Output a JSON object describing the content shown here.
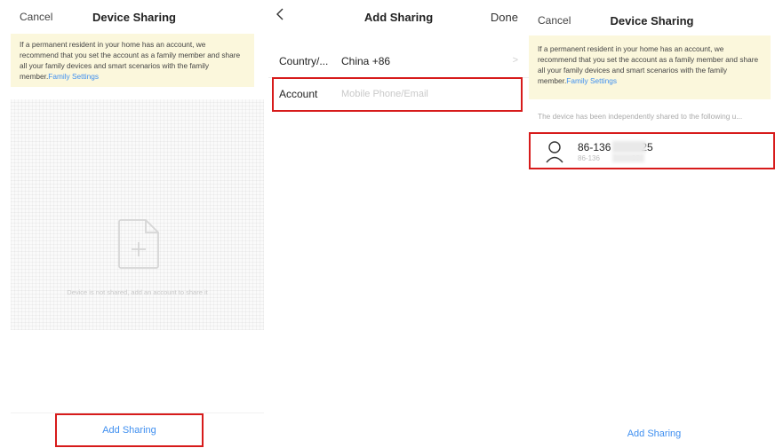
{
  "panel1": {
    "nav": {
      "cancel": "Cancel",
      "title": "Device Sharing"
    },
    "notice": {
      "text": "If a permanent resident in your home has an account, we recommend that you set the account as a family member and share all your family devices and smart scenarios with the family member.",
      "link": "Family Settings"
    },
    "empty_text": "Device is not shared, add an account to share it",
    "empty_icon": "add-file-icon",
    "add_button": "Add Sharing"
  },
  "panel2": {
    "nav": {
      "back_icon": "chevron-left-icon",
      "back": "<",
      "title": "Add Sharing",
      "done": "Done"
    },
    "country": {
      "label": "Country/...",
      "value": "China +86",
      "chevron": ">"
    },
    "account": {
      "label": "Account",
      "placeholder": "Mobile Phone/Email"
    }
  },
  "panel3": {
    "nav": {
      "cancel": "Cancel",
      "title": "Device Sharing"
    },
    "notice": {
      "text": "If a permanent resident in your home has an account, we recommend that you set the account as a family member and share all your family devices and smart scenarios with the family member.",
      "link": "Family Settings"
    },
    "shared_caption": "The device has been independently shared to the following u...",
    "user": {
      "avatar_icon": "user-icon",
      "name_start": "86-136",
      "name_end": "25",
      "sub_start": "86-136",
      "sub_end": "25"
    },
    "add_link": "Add Sharing"
  },
  "colors": {
    "accent": "#3f8ff0",
    "notice_bg": "#fbf7dc",
    "highlight": "#d71b1b"
  }
}
